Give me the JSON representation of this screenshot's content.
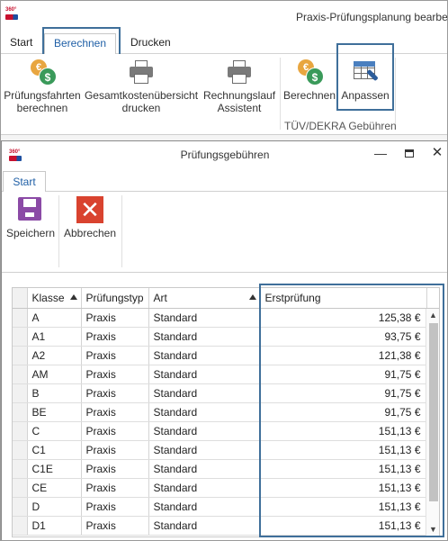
{
  "app": {
    "title": "Praxis-Prüfungsplanung bearbei",
    "tabs": [
      "Start",
      "Berechnen",
      "Drucken"
    ],
    "ribbon": {
      "buttons": [
        {
          "line1": "Prüfungsfahrten",
          "line2": "berechnen"
        },
        {
          "line1": "Gesamtkostenübersicht",
          "line2": "drucken"
        },
        {
          "line1": "Rechnungslauf",
          "line2": "Assistent"
        },
        {
          "line1": "Berechnen",
          "line2": ""
        },
        {
          "line1": "Anpassen",
          "line2": ""
        }
      ],
      "group_label": "TÜV/DEKRA Gebühren"
    }
  },
  "dialog": {
    "title": "Prüfungsgebühren",
    "tab": "Start",
    "buttons": {
      "save": "Speichern",
      "cancel": "Abbrechen"
    },
    "grid": {
      "columns": [
        "Klasse",
        "Prüfungstyp",
        "Art",
        "Erstprüfung"
      ],
      "rows": [
        [
          "A",
          "Praxis",
          "Standard",
          "125,38 €"
        ],
        [
          "A1",
          "Praxis",
          "Standard",
          "93,75 €"
        ],
        [
          "A2",
          "Praxis",
          "Standard",
          "121,38 €"
        ],
        [
          "AM",
          "Praxis",
          "Standard",
          "91,75 €"
        ],
        [
          "B",
          "Praxis",
          "Standard",
          "91,75 €"
        ],
        [
          "BE",
          "Praxis",
          "Standard",
          "91,75 €"
        ],
        [
          "C",
          "Praxis",
          "Standard",
          "151,13 €"
        ],
        [
          "C1",
          "Praxis",
          "Standard",
          "151,13 €"
        ],
        [
          "C1E",
          "Praxis",
          "Standard",
          "151,13 €"
        ],
        [
          "CE",
          "Praxis",
          "Standard",
          "151,13 €"
        ],
        [
          "D",
          "Praxis",
          "Standard",
          "151,13 €"
        ],
        [
          "D1",
          "Praxis",
          "Standard",
          "151,13 €"
        ]
      ]
    }
  },
  "colors": {
    "accent": "#1f5fa6",
    "highlight_border": "#3f6f9a",
    "save_icon": "#8b4aa6",
    "cancel_icon": "#d9432f"
  }
}
